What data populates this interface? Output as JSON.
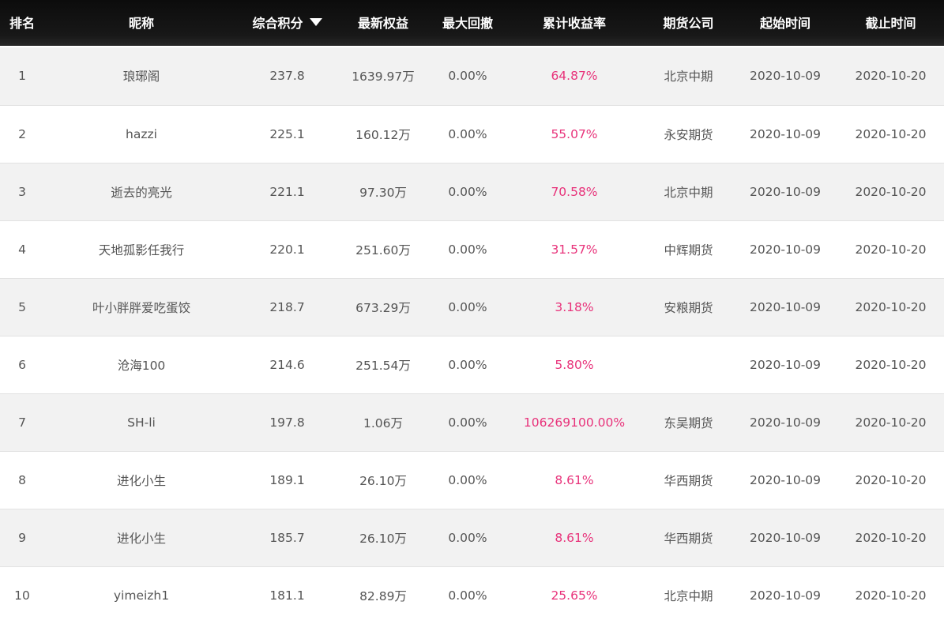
{
  "table": {
    "headers": {
      "rank": "排名",
      "nickname": "昵称",
      "score": "综合积分",
      "equity": "最新权益",
      "drawdown": "最大回撤",
      "return": "累计收益率",
      "company": "期货公司",
      "start": "起始时间",
      "end": "截止时间"
    },
    "sort": {
      "column": "score",
      "direction": "descending",
      "icon": "caret-down-icon"
    },
    "accent_color": "#e8327a",
    "rows": [
      {
        "rank": "1",
        "nickname": "琅琊阁",
        "score": "237.8",
        "equity": "1639.97万",
        "drawdown": "0.00%",
        "return": "64.87%",
        "company": "北京中期",
        "start": "2020-10-09",
        "end": "2020-10-20"
      },
      {
        "rank": "2",
        "nickname": "hazzi",
        "score": "225.1",
        "equity": "160.12万",
        "drawdown": "0.00%",
        "return": "55.07%",
        "company": "永安期货",
        "start": "2020-10-09",
        "end": "2020-10-20"
      },
      {
        "rank": "3",
        "nickname": "逝去的亮光",
        "score": "221.1",
        "equity": "97.30万",
        "drawdown": "0.00%",
        "return": "70.58%",
        "company": "北京中期",
        "start": "2020-10-09",
        "end": "2020-10-20"
      },
      {
        "rank": "4",
        "nickname": "天地孤影任我行",
        "score": "220.1",
        "equity": "251.60万",
        "drawdown": "0.00%",
        "return": "31.57%",
        "company": "中辉期货",
        "start": "2020-10-09",
        "end": "2020-10-20"
      },
      {
        "rank": "5",
        "nickname": "叶小胖胖爱吃蛋饺",
        "score": "218.7",
        "equity": "673.29万",
        "drawdown": "0.00%",
        "return": "3.18%",
        "company": "安粮期货",
        "start": "2020-10-09",
        "end": "2020-10-20"
      },
      {
        "rank": "6",
        "nickname": "沧海100",
        "score": "214.6",
        "equity": "251.54万",
        "drawdown": "0.00%",
        "return": "5.80%",
        "company": "",
        "start": "2020-10-09",
        "end": "2020-10-20"
      },
      {
        "rank": "7",
        "nickname": "SH-li",
        "score": "197.8",
        "equity": "1.06万",
        "drawdown": "0.00%",
        "return": "106269100.00%",
        "company": "东吴期货",
        "start": "2020-10-09",
        "end": "2020-10-20"
      },
      {
        "rank": "8",
        "nickname": "进化小生",
        "score": "189.1",
        "equity": "26.10万",
        "drawdown": "0.00%",
        "return": "8.61%",
        "company": "华西期货",
        "start": "2020-10-09",
        "end": "2020-10-20"
      },
      {
        "rank": "9",
        "nickname": "进化小生",
        "score": "185.7",
        "equity": "26.10万",
        "drawdown": "0.00%",
        "return": "8.61%",
        "company": "华西期货",
        "start": "2020-10-09",
        "end": "2020-10-20"
      },
      {
        "rank": "10",
        "nickname": "yimeizh1",
        "score": "181.1",
        "equity": "82.89万",
        "drawdown": "0.00%",
        "return": "25.65%",
        "company": "北京中期",
        "start": "2020-10-09",
        "end": "2020-10-20"
      }
    ]
  }
}
